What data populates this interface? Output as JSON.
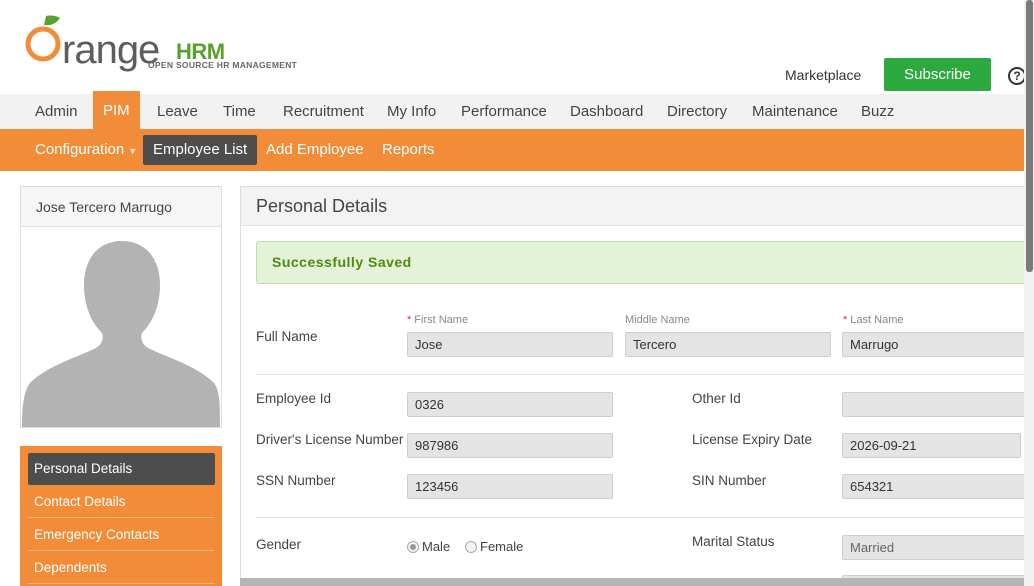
{
  "brand": {
    "logo_word": "range",
    "logo_o": "O",
    "logo_hrm": "HRM",
    "tagline": "OPEN SOURCE HR MANAGEMENT",
    "accent": "#f28c38",
    "green": "#2daa3f"
  },
  "header": {
    "marketplace": "Marketplace",
    "subscribe": "Subscribe",
    "help_icon": "?"
  },
  "main_nav": [
    {
      "label": "Admin"
    },
    {
      "label": "PIM",
      "active": true
    },
    {
      "label": "Leave"
    },
    {
      "label": "Time"
    },
    {
      "label": "Recruitment"
    },
    {
      "label": "My Info"
    },
    {
      "label": "Performance"
    },
    {
      "label": "Dashboard"
    },
    {
      "label": "Directory"
    },
    {
      "label": "Maintenance"
    },
    {
      "label": "Buzz"
    }
  ],
  "sub_nav": [
    {
      "label": "Configuration",
      "dropdown": true
    },
    {
      "label": "Employee List",
      "active": true
    },
    {
      "label": "Add Employee"
    },
    {
      "label": "Reports"
    }
  ],
  "profile": {
    "name": "Jose Tercero Marrugo",
    "avatar_icon": "person-silhouette-icon"
  },
  "side_menu": [
    {
      "label": "Personal Details",
      "active": true
    },
    {
      "label": "Contact Details"
    },
    {
      "label": "Emergency Contacts"
    },
    {
      "label": "Dependents"
    }
  ],
  "panel": {
    "title": "Personal Details",
    "success_message": "Successfully Saved",
    "full_name_label": "Full Name",
    "first_name_label": "First Name",
    "middle_name_label": "Middle Name",
    "last_name_label": "Last Name",
    "first_name": "Jose",
    "middle_name": "Tercero",
    "last_name": "Marrugo",
    "employee_id_label": "Employee Id",
    "employee_id": "0326",
    "other_id_label": "Other Id",
    "other_id": "",
    "license_label": "Driver's License Number",
    "license": "987986",
    "license_expiry_label": "License Expiry Date",
    "license_expiry": "2026-09-21",
    "ssn_label": "SSN Number",
    "ssn": "123456",
    "sin_label": "SIN Number",
    "sin": "654321",
    "gender_label": "Gender",
    "gender_male": "Male",
    "gender_female": "Female",
    "gender_selected": "Male",
    "marital_label": "Marital Status",
    "marital": "Married"
  }
}
